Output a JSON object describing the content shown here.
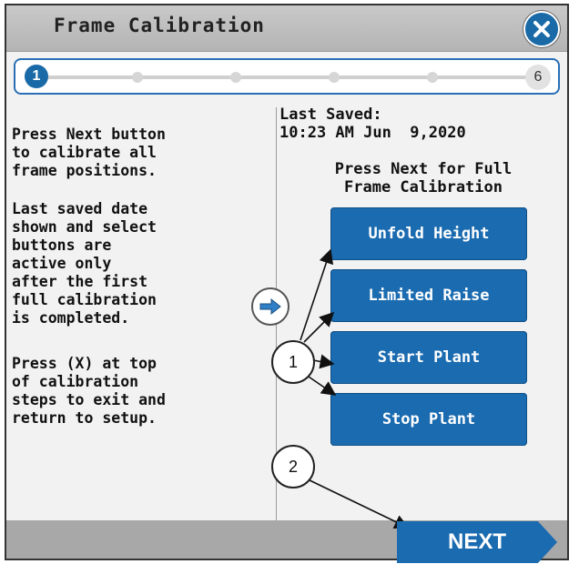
{
  "window": {
    "title": "Frame Calibration",
    "close_icon": "close-x-icon",
    "accent": "#1b6bb0"
  },
  "progress": {
    "current_step": "1",
    "total_steps": "6"
  },
  "instructions": {
    "p1": "Press Next button\nto calibrate all\nframe positions.",
    "p2": "Last saved date\nshown and select\nbuttons are\nactive only\nafter the first\nfull calibration\nis completed.",
    "p3": "Press (X) at top\nof calibration\nsteps to exit and\nreturn to setup."
  },
  "saved": {
    "label": "Last Saved:",
    "value": "10:23 AM Jun  9,2020"
  },
  "full_calibration": {
    "prompt": "Press Next for Full\nFrame Calibration"
  },
  "buttons": [
    {
      "label": "Unfold Height"
    },
    {
      "label": "Limited Raise"
    },
    {
      "label": "Start Plant"
    },
    {
      "label": "Stop Plant"
    }
  ],
  "callouts": {
    "one": "1",
    "two": "2"
  },
  "footer": {
    "next_label": "NEXT"
  }
}
